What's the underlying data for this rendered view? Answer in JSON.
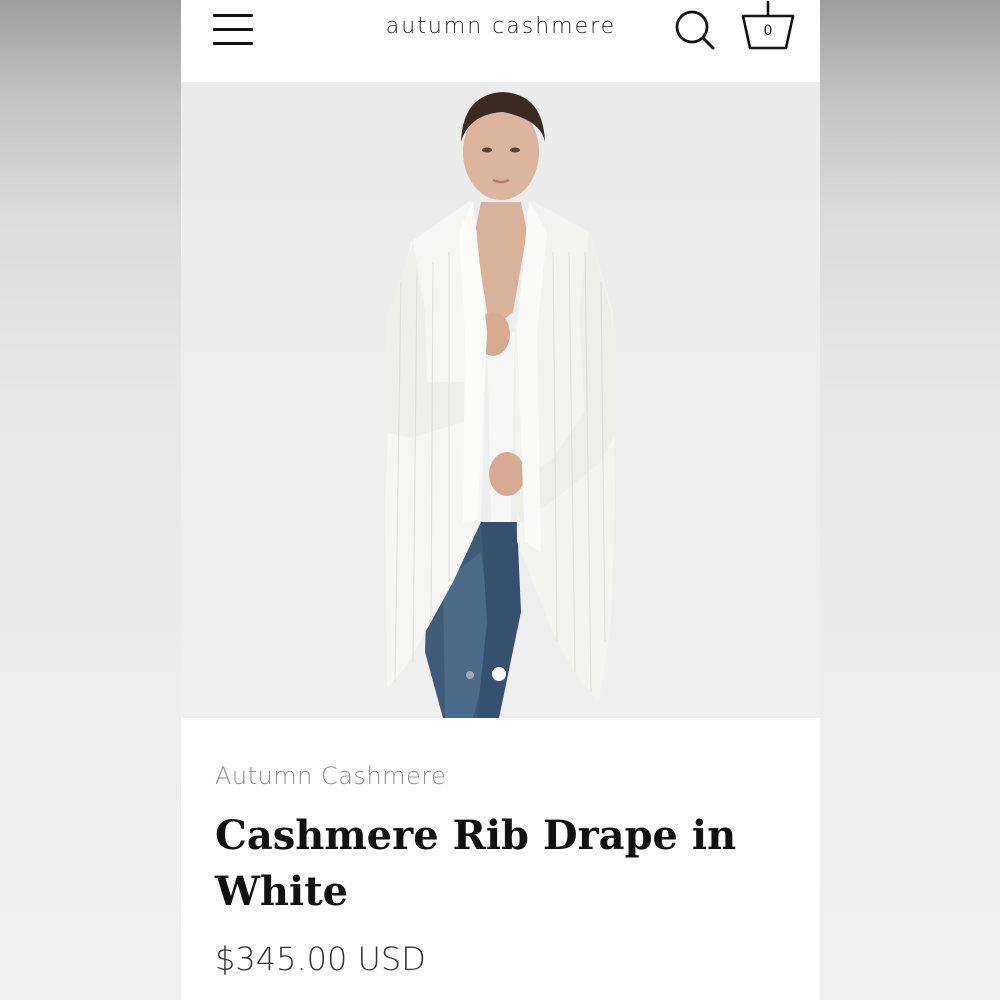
{
  "header": {
    "brand": "autumn cashmere",
    "cart_count": "0",
    "icons": {
      "menu": "hamburger-menu-icon",
      "search": "search-icon",
      "cart": "basket-icon"
    }
  },
  "gallery": {
    "image_alt": "Model wearing white ribbed cashmere drape cardigan with jeans",
    "slide_count": 2,
    "active_slide": 2
  },
  "product": {
    "vendor": "Autumn Cashmere",
    "title": "Cashmere Rib Drape in White",
    "price": "$345.00 USD"
  }
}
